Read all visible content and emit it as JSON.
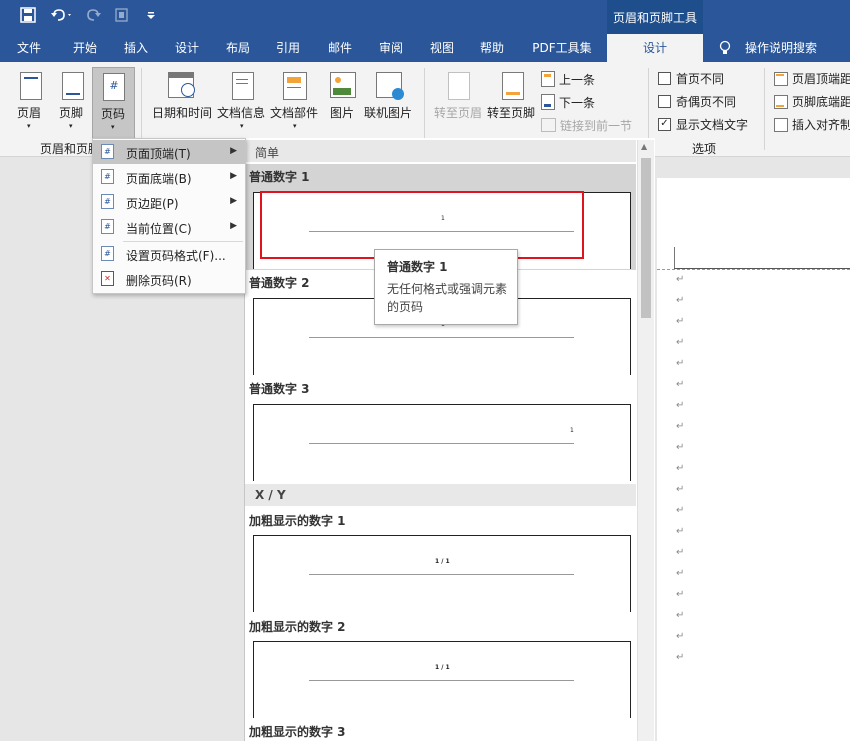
{
  "titlebar": {
    "context_tab_title": "页眉和页脚工具"
  },
  "tabs": [
    "文件",
    "开始",
    "插入",
    "设计",
    "布局",
    "引用",
    "邮件",
    "审阅",
    "视图",
    "帮助",
    "PDF工具集",
    "设计"
  ],
  "search_label": "操作说明搜索",
  "ribbon": {
    "header_label": "页眉",
    "footer_label": "页脚",
    "page_number_label": "页码",
    "group_header_footer": "页眉和页脚",
    "date_time_label": "日期和时间",
    "doc_info_label": "文档信息",
    "doc_parts_label": "文档部件",
    "picture_label": "图片",
    "online_picture_label": "联机图片",
    "goto_header_label": "转至页眉",
    "goto_footer_label": "转至页脚",
    "prev_label": "上一条",
    "next_label": "下一条",
    "link_prev_label": "链接到前一节",
    "different_first_page": "首页不同",
    "different_odd_even": "奇偶页不同",
    "show_doc_text": "显示文档文字",
    "group_options": "选项",
    "header_top_distance": "页眉顶端距",
    "footer_bottom_distance": "页脚底端距",
    "insert_align_tab": "插入对齐制"
  },
  "menu": {
    "items": [
      {
        "label": "页面顶端(T)"
      },
      {
        "label": "页面底端(B)"
      },
      {
        "label": "页边距(P)"
      },
      {
        "label": "当前位置(C)"
      },
      {
        "label": "设置页码格式(F)..."
      },
      {
        "label": "删除页码(R)"
      }
    ]
  },
  "gallery": {
    "category_simple": "简单",
    "category_xy": "X / Y",
    "items": [
      {
        "title": "普通数字 1",
        "num": "1"
      },
      {
        "title": "普通数字 2",
        "num": "1"
      },
      {
        "title": "普通数字 3",
        "num": "1"
      },
      {
        "title": "加粗显示的数字 1",
        "num": "1 / 1"
      },
      {
        "title": "加粗显示的数字 2",
        "num": "1 / 1"
      },
      {
        "title": "加粗显示的数字 3",
        "num": ""
      }
    ]
  },
  "tooltip": {
    "title": "普通数字 1",
    "desc_line1": "无任何格式或强调元素",
    "desc_line2": "的页码"
  },
  "document": {
    "paragraph_mark": "↵"
  },
  "colors": {
    "accent": "#2b579a",
    "highlight_box": "#e0141e"
  }
}
